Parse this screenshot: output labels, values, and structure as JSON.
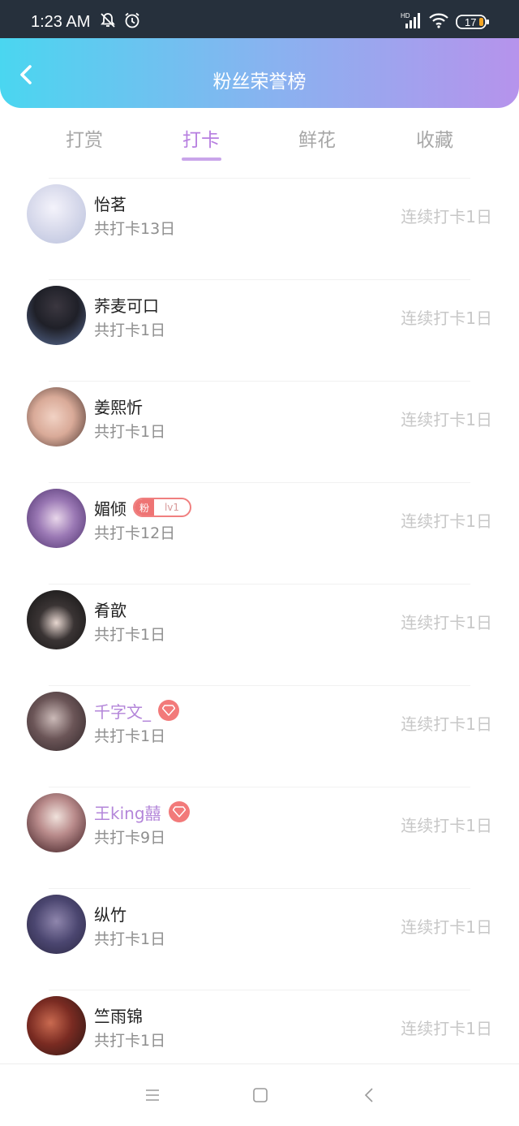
{
  "status_bar": {
    "time": "1:23 AM",
    "battery": "17",
    "icons": [
      "bell-off-icon",
      "alarm-icon",
      "signal-icon",
      "wifi-icon",
      "battery-icon"
    ]
  },
  "header": {
    "title": "粉丝荣誉榜",
    "back_icon": "chevron-left-icon"
  },
  "tabs": [
    {
      "label": "打赏",
      "active": false
    },
    {
      "label": "打卡",
      "active": true
    },
    {
      "label": "鲜花",
      "active": false
    },
    {
      "label": "收藏",
      "active": false
    }
  ],
  "rows": [
    {
      "name": "怡茗",
      "total": "共打卡13日",
      "streak": "连续打卡1日"
    },
    {
      "name": "荞麦可口",
      "total": "共打卡1日",
      "streak": "连续打卡1日"
    },
    {
      "name": "姜熙忻",
      "total": "共打卡1日",
      "streak": "连续打卡1日"
    },
    {
      "name": "媚倾",
      "total": "共打卡12日",
      "streak": "连续打卡1日",
      "badge_fan": "粉",
      "badge_level": "lv1"
    },
    {
      "name": "肴歆",
      "total": "共打卡1日",
      "streak": "连续打卡1日"
    },
    {
      "name": "千字文_",
      "total": "共打卡1日",
      "streak": "连续打卡1日",
      "vip": true
    },
    {
      "name": "王king囍",
      "total": "共打卡9日",
      "streak": "连续打卡1日",
      "vip": true
    },
    {
      "name": "纵竹",
      "total": "共打卡1日",
      "streak": "连续打卡1日"
    },
    {
      "name": "竺雨锦",
      "total": "共打卡1日",
      "streak": "连续打卡1日"
    }
  ],
  "colors": {
    "accent": "#b77fe0",
    "header_gradient_start": "#4ad6f0",
    "header_gradient_end": "#b693ec",
    "vip_badge": "#f27a7a"
  },
  "nav_bar": {
    "icons": [
      "menu-icon",
      "home-square-icon",
      "back-triangle-icon"
    ]
  }
}
